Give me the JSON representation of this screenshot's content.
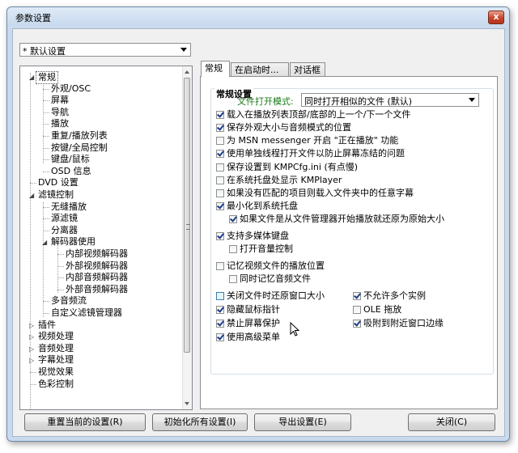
{
  "window": {
    "title": "参数设置",
    "close_glyph": "x"
  },
  "preset": {
    "value": "* 默认设置"
  },
  "tree": {
    "items": [
      {
        "label": "常规",
        "level": 1,
        "expander": "open",
        "selected": true
      },
      {
        "label": "外观/OSC",
        "level": 2
      },
      {
        "label": "屏幕",
        "level": 2
      },
      {
        "label": "导航",
        "level": 2
      },
      {
        "label": "播放",
        "level": 2
      },
      {
        "label": "重复/播放列表",
        "level": 2
      },
      {
        "label": "按键/全局控制",
        "level": 2
      },
      {
        "label": "键盘/鼠标",
        "level": 2
      },
      {
        "label": "OSD 信息",
        "level": 2
      },
      {
        "label": "DVD 设置",
        "level": 1
      },
      {
        "label": "滤镜控制",
        "level": 1,
        "expander": "open"
      },
      {
        "label": "无缝播放",
        "level": 2
      },
      {
        "label": "源滤镜",
        "level": 2
      },
      {
        "label": "分离器",
        "level": 2
      },
      {
        "label": "解码器使用",
        "level": 2,
        "expander": "open"
      },
      {
        "label": "内部视频解码器",
        "level": 3
      },
      {
        "label": "外部视频解码器",
        "level": 3
      },
      {
        "label": "内部音频解码器",
        "level": 3
      },
      {
        "label": "外部音频解码器",
        "level": 3
      },
      {
        "label": "多音频流",
        "level": 2
      },
      {
        "label": "自定义滤镜管理器",
        "level": 2
      },
      {
        "label": "插件",
        "level": 1,
        "expander": "closed"
      },
      {
        "label": "视频处理",
        "level": 1,
        "expander": "closed"
      },
      {
        "label": "音频处理",
        "level": 1,
        "expander": "closed"
      },
      {
        "label": "字幕处理",
        "level": 1,
        "expander": "closed"
      },
      {
        "label": "视觉效果",
        "level": 1
      },
      {
        "label": "色彩控制",
        "level": 1
      }
    ]
  },
  "tabs": [
    {
      "label": "常规",
      "active": true
    },
    {
      "label": "在启动时...",
      "active": false
    },
    {
      "label": "对话框",
      "active": false
    }
  ],
  "general": {
    "group_title": "常规设置",
    "open_mode_label": "文件打开模式:",
    "open_mode_value": "同时打开相似的文件 (默认)",
    "options": [
      {
        "label": "载入在播放列表顶部/底部的上一个/下一个文件",
        "checked": true
      },
      {
        "label": "保存外观大小与音频模式的位置",
        "checked": true
      },
      {
        "label": "为 MSN messenger 开启 \"正在播放\" 功能",
        "checked": false
      },
      {
        "label": "使用单独线程打开文件以防止屏幕冻结的问题",
        "checked": true
      },
      {
        "label": "保存设置到 KMPCfg.ini (有点慢)",
        "checked": false
      },
      {
        "label": "在系统托盘处显示 KMPlayer",
        "checked": false
      },
      {
        "label": "如果没有匹配的项目则载入文件夹中的任意字幕",
        "checked": false
      },
      {
        "label": "最小化到系统托盘",
        "checked": true
      },
      {
        "label": "如果文件是从文件管理器开始播放就还原为原始大小",
        "checked": true
      },
      {
        "label": "支持多媒体键盘",
        "checked": true
      },
      {
        "label": "打开音量控制",
        "checked": false
      },
      {
        "label": "记忆视频文件的播放位置",
        "checked": false
      },
      {
        "label": "同时记忆音频文件",
        "checked": false
      },
      {
        "label": "关闭文件时还原窗口大小",
        "checked": false,
        "hover": true
      },
      {
        "label": "隐藏鼠标指针",
        "checked": true
      },
      {
        "label": "禁止屏幕保护",
        "checked": true
      },
      {
        "label": "使用高级菜单",
        "checked": true
      },
      {
        "label": "不允许多个实例",
        "checked": true
      },
      {
        "label": "OLE 拖放",
        "checked": false
      },
      {
        "label": "吸附到附近窗口边缘",
        "checked": true
      }
    ]
  },
  "buttons": {
    "reset_current": "重置当前的设置(R)",
    "init_all": "初始化所有设置(I)",
    "export": "导出设置(E)",
    "close": "关闭(C)"
  },
  "colors": {
    "accent_green": "#1a7a1a",
    "check_blue": "#1c3b8a",
    "close_red": "#c6442a"
  }
}
